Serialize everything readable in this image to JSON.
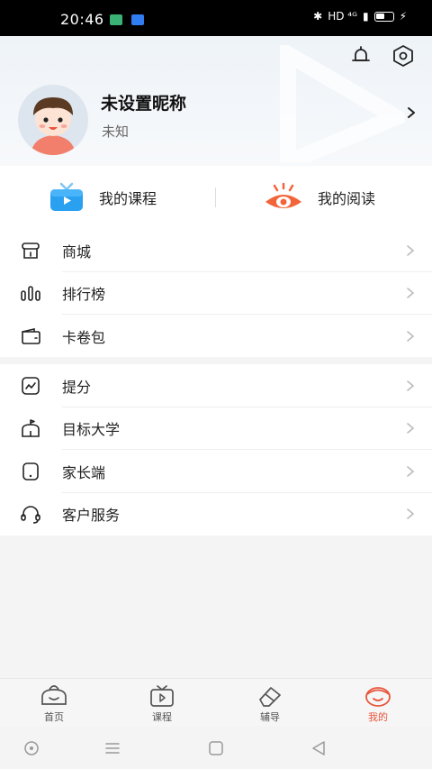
{
  "status_bar": {
    "time": "20:46",
    "indicators": "HD ⁴ᴳ"
  },
  "profile": {
    "nickname": "未设置昵称",
    "gender": "未知"
  },
  "quick_links": [
    {
      "label": "我的课程",
      "icon": "tv-icon"
    },
    {
      "label": "我的阅读",
      "icon": "eye-book-icon"
    }
  ],
  "menu_group_1": [
    {
      "label": "商城",
      "icon": "shop-icon"
    },
    {
      "label": "排行榜",
      "icon": "ranking-icon"
    },
    {
      "label": "卡卷包",
      "icon": "wallet-icon"
    }
  ],
  "menu_group_2": [
    {
      "label": "提分",
      "icon": "chart-icon"
    },
    {
      "label": "目标大学",
      "icon": "university-icon"
    },
    {
      "label": "家长端",
      "icon": "parent-icon"
    },
    {
      "label": "客户服务",
      "icon": "headset-icon"
    }
  ],
  "tabs": [
    {
      "label": "首页",
      "icon": "home-icon"
    },
    {
      "label": "课程",
      "icon": "course-icon"
    },
    {
      "label": "辅导",
      "icon": "eraser-icon"
    },
    {
      "label": "我的",
      "icon": "me-icon",
      "active": true
    }
  ],
  "colors": {
    "accent": "#e8553b",
    "quick_course": "#2aa0f0",
    "quick_read": "#f2653a"
  }
}
